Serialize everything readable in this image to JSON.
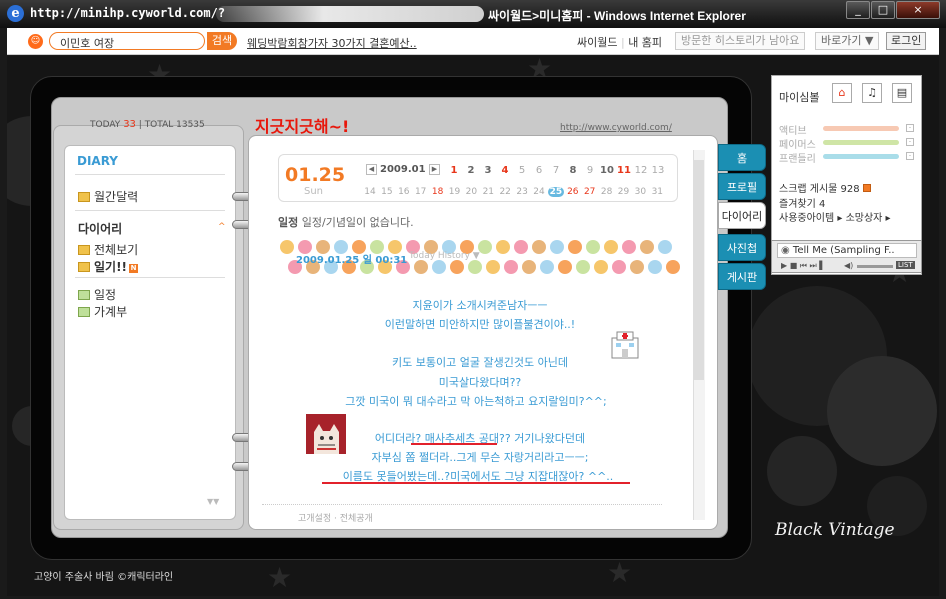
{
  "window": {
    "url_prefix": "http://minihp.cyworld.com/?",
    "title_suffix": "싸이월드>미니홈피 - Windows Internet Explorer",
    "min": "_",
    "max": "□",
    "close": "×"
  },
  "nav": {
    "search_value": "이민호 여장",
    "search_btn": "검색",
    "ad_text": "웨딩박람회참가자 30가지 결혼예산..",
    "link1": "싸이월드",
    "link2": "내 홈피",
    "history_btn": "방문한 히스토리가 남아요",
    "goto_btn": "바로가기 ▼",
    "login": "로그인"
  },
  "counter": {
    "today_label": "TODAY",
    "today": "33",
    "total_label": "TOTAL",
    "total": "13535"
  },
  "left": {
    "heading": "DIARY",
    "monthly": "월간달력",
    "diary_title": "다이어리",
    "view_all": "전체보기",
    "diary_item": "일기!!",
    "badge": "N",
    "schedule": "일정",
    "ledger": "가계부"
  },
  "home": {
    "title": "지긋지긋해~!",
    "url": "http://www.cyworld.com/"
  },
  "calendar": {
    "date": "01.25",
    "weekday": "Sun",
    "month": "2009.01",
    "days_row1": [
      "1",
      "2",
      "3",
      "4",
      "5",
      "6",
      "7",
      "8",
      "9",
      "10",
      "11",
      "12",
      "13"
    ],
    "days_row2": [
      "14",
      "15",
      "16",
      "17",
      "18",
      "19",
      "20",
      "21",
      "22",
      "23",
      "24",
      "25",
      "26",
      "27",
      "28",
      "29",
      "30",
      "31"
    ]
  },
  "schedule": {
    "label": "일정",
    "text": "일정/기념일이 없습니다."
  },
  "post": {
    "stamp": "2009.01.25 일  00:31",
    "history": "Today History ▼",
    "lines": [
      "지윤이가 소개시켜준남자ㅡㅡ",
      "이런말하면 미안하지만 많이플불견이야..!",
      "",
      "키도 보통이고 얼굴 잘생긴것도 아닌데",
      "미국살다왔다며??",
      "그깟 미국이 뭐 대수라고 막 아는척하고 요지랄임미?^^;",
      "",
      "어디더라? 매사추세츠 공대?? 거기나왔다던데",
      "자부심 쫌 쩔더라..그게 무슨 자랑거리라고ㅡㅡ;",
      "이름도 못들어봤는데..?미국에서도 그냥 지잡대잖아? ^^.."
    ],
    "footer": "고개설정 · 전체공개"
  },
  "tabs": [
    "홈",
    "프로필",
    "다이어리",
    "사진첩",
    "게시판"
  ],
  "widget": {
    "mood": "마이심볼",
    "rows": [
      "액티브",
      "페이머스",
      "프랜들리"
    ],
    "board": "스크랩 게시물 928",
    "fav": "즐겨찾기 4",
    "items": "사용중아이템 ▸ 소망상자 ▸",
    "music": "Tell Me (Sampling F..",
    "list": "LIST",
    "colors": [
      "#f7c9b3",
      "#cfe5a6",
      "#a9dde9"
    ]
  },
  "skin": {
    "credit": "고양이 주술사 바림 ©캐릭터라인",
    "name": "Black Vintage"
  }
}
